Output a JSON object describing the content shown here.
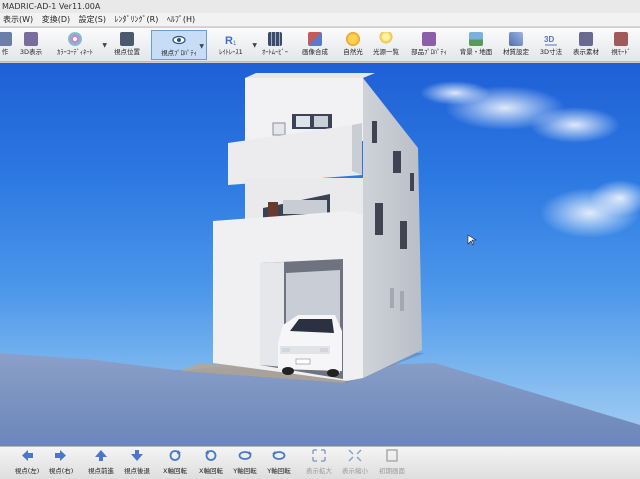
{
  "window": {
    "title": "MADRIC-AD-1 Ver11.00A"
  },
  "menu": [
    {
      "label": "表示(W)"
    },
    {
      "label": "変換(D)"
    },
    {
      "label": "設定(S)"
    },
    {
      "label": "ﾚﾝﾀﾞﾘﾝｸﾞ(R)"
    },
    {
      "label": "ﾍﾙﾌﾟ(H)"
    }
  ],
  "toolbar": [
    {
      "label": "作",
      "icon": "file-icon",
      "color": "#6a7fa8"
    },
    {
      "label": "3D表示",
      "icon": "3d-view-icon",
      "color": "#7a6c9c"
    },
    {
      "label": "ｶﾗｰｺｰﾃﾞｨﾈｰﾄ",
      "icon": "color-wheel-icon",
      "color": "#d27ad4"
    },
    {
      "label": "視点位置",
      "icon": "camera-icon",
      "color": "#4c5a6e"
    },
    {
      "label": "視点ﾌﾟﾛﾊﾟﾃｨ",
      "icon": "eye-icon",
      "color": "#2b4f8c"
    },
    {
      "label": "ﾚｲﾄﾚｰｽ1",
      "icon": "raytrace-icon",
      "color": "#3f6fc4"
    },
    {
      "label": "ｵｰﾄﾑｰﾋﾞｰ",
      "icon": "film-icon",
      "color": "#3a4c6a"
    },
    {
      "label": "画像合成",
      "icon": "image-compose-icon",
      "color": "#c65a5a"
    },
    {
      "label": "自然光",
      "icon": "sun-icon",
      "color": "#e3a23a"
    },
    {
      "label": "光源一覧",
      "icon": "light-icon",
      "color": "#e8c14a"
    },
    {
      "label": "部品ﾌﾟﾛﾊﾟﾃｨ",
      "icon": "parts-icon",
      "color": "#8a5ea8"
    },
    {
      "label": "背景・地面",
      "icon": "landscape-icon",
      "color": "#5a9a58"
    },
    {
      "label": "材質設定",
      "icon": "material-icon",
      "color": "#4f6fb0"
    },
    {
      "label": "3D寸法",
      "icon": "3d-dimension-icon",
      "color": "#5b72c8"
    },
    {
      "label": "表示素材",
      "icon": "display-material-icon",
      "color": "#6a6a90"
    },
    {
      "label": "視ﾓｰﾄﾞ",
      "icon": "view-mode-icon",
      "color": "#a05a5a"
    }
  ],
  "bottombar": [
    {
      "label": "視点(左)",
      "icon": "arrow-left-icon"
    },
    {
      "label": "視点(右)",
      "icon": "arrow-right-icon"
    },
    {
      "label": "視点前進",
      "icon": "arrow-up-icon"
    },
    {
      "label": "視点後退",
      "icon": "arrow-down-icon"
    },
    {
      "label": "X軸回転",
      "icon": "rotate-x-icon"
    },
    {
      "label": "X軸回転",
      "icon": "rotate-x-reverse-icon"
    },
    {
      "label": "Y軸回転",
      "icon": "rotate-y-icon"
    },
    {
      "label": "Y軸回転",
      "icon": "rotate-y-reverse-icon"
    },
    {
      "label": "表示拡大",
      "icon": "zoom-in-icon"
    },
    {
      "label": "表示縮小",
      "icon": "zoom-out-icon"
    },
    {
      "label": "初期画面",
      "icon": "home-view-icon"
    }
  ],
  "colors": {
    "accent": "#6d9bd2",
    "active_bg": "#c7dcf5",
    "sky_top": "#1f5fd6",
    "sky_bottom": "#a9d0f2",
    "ground": "#7d96c4"
  }
}
